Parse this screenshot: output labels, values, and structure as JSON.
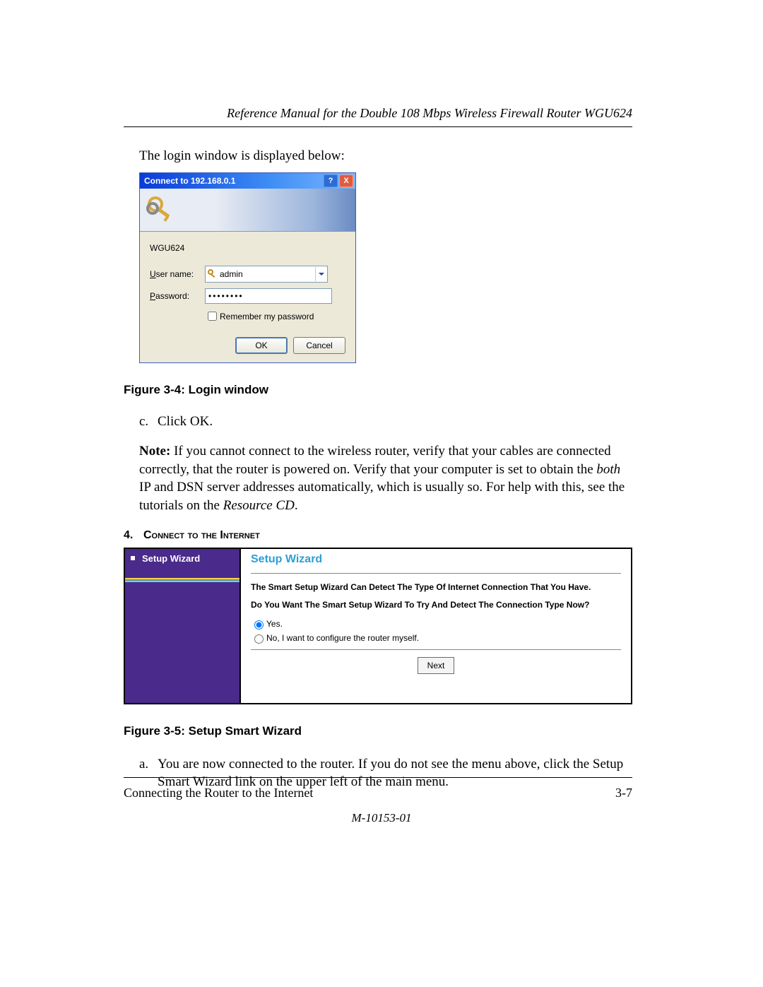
{
  "header": "Reference Manual for the Double 108 Mbps Wireless Firewall Router WGU624",
  "intro": "The login window is displayed below:",
  "login": {
    "title": "Connect to 192.168.0.1",
    "host": "WGU624",
    "user_label_pre": "U",
    "user_label_post": "ser name:",
    "user_value": "admin",
    "pw_label_pre": "P",
    "pw_label_post": "assword:",
    "pw_value": "••••••••",
    "remember_pre": "R",
    "remember_post": "emember my password",
    "ok": "OK",
    "cancel": "Cancel"
  },
  "fig1": "Figure 3-4:  Login window",
  "stepc_marker": "c.",
  "stepc_text": "Click OK.",
  "note_lead": "Note:",
  "note_1": " If you cannot connect to the wireless router, verify that your cables are connected correctly, that the router is powered on. Verify that your computer is set to obtain the ",
  "note_em": "both",
  "note_2": " IP and DSN server addresses automatically, which is usually so. For help with this, see the tutorials on the ",
  "note_cd": "Resource CD",
  "note_3": ".",
  "step4_num": "4.",
  "step4_heading": "Connect to the Internet",
  "wizard": {
    "side_item": "Setup Wizard",
    "title": "Setup Wizard",
    "p1": "The Smart Setup Wizard Can Detect The Type Of Internet Connection That You Have.",
    "p2": "Do You Want The Smart Setup Wizard To Try And Detect The Connection Type Now?",
    "yes": "Yes.",
    "no": "No, I want to configure the router myself.",
    "next": "Next"
  },
  "fig2": "Figure 3-5:  Setup Smart Wizard",
  "stepa_marker": "a.",
  "stepa_text": "You are now connected to the router. If you do not see the menu above, click the Setup Smart Wizard link on the upper left of the main menu.",
  "footer_left": "Connecting the Router to the Internet",
  "footer_right": "3-7",
  "doc_id": "M-10153-01"
}
